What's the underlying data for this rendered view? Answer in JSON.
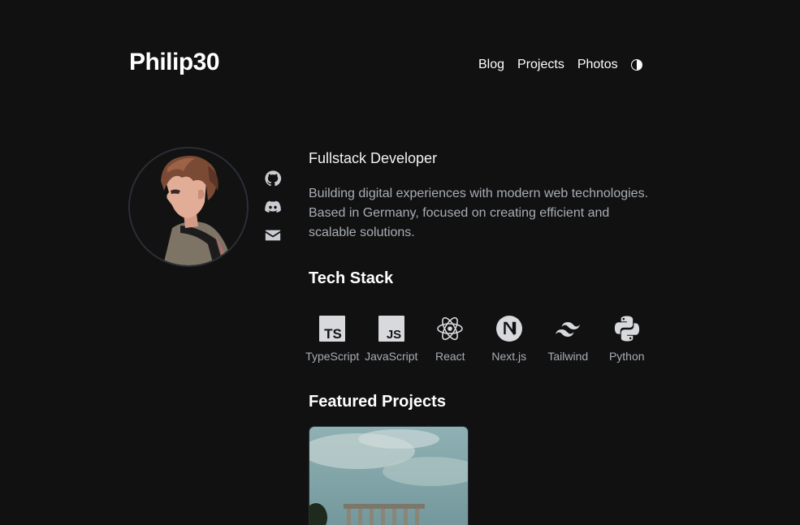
{
  "header": {
    "brand": "Philip30",
    "nav": [
      {
        "label": "Blog"
      },
      {
        "label": "Projects"
      },
      {
        "label": "Photos"
      }
    ],
    "theme_toggle_icon": "half-circle-icon"
  },
  "profile": {
    "avatar_icon": "anime-avatar",
    "socials": [
      {
        "icon": "github-icon"
      },
      {
        "icon": "discord-icon"
      },
      {
        "icon": "mail-icon"
      }
    ]
  },
  "intro": {
    "role": "Fullstack Developer",
    "bio": "Building digital experiences with modern web technologies. Based in Germany, focused on creating efficient and scalable solutions."
  },
  "tech_stack": {
    "title": "Tech Stack",
    "items": [
      {
        "label": "TypeScript",
        "icon": "typescript-icon"
      },
      {
        "label": "JavaScript",
        "icon": "javascript-icon"
      },
      {
        "label": "React",
        "icon": "react-icon"
      },
      {
        "label": "Next.js",
        "icon": "nextjs-icon"
      },
      {
        "label": "Tailwind",
        "icon": "tailwind-icon"
      },
      {
        "label": "Python",
        "icon": "python-icon"
      }
    ]
  },
  "projects": {
    "title": "Featured Projects"
  },
  "colors": {
    "background": "#111111",
    "text": "#f2f2f2",
    "muted": "#a8adb5",
    "icon": "#c9ccd1"
  }
}
